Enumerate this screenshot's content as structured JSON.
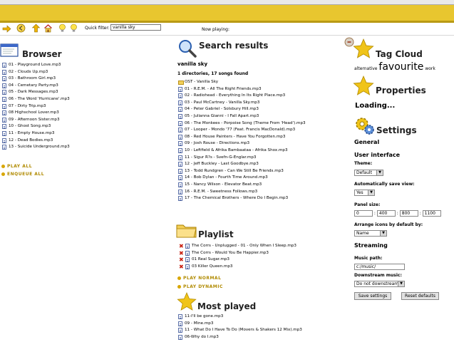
{
  "toolbar": {
    "quick_filter_label": "Quick filter:",
    "quick_filter_value": "vanilla sky",
    "now_playing_label": "Now playing:",
    "icons": [
      "arrow-right-icon",
      "back-icon",
      "up-arrow-icon",
      "home-icon",
      "bulb-icon",
      "bulb-icon"
    ]
  },
  "browser": {
    "title": "Browser",
    "files": [
      "01 - Playground Love.mp3",
      "02 - Clouds Up.mp3",
      "03 - Bathroom Girl.mp3",
      "04 - Cemetary Party.mp3",
      "05 - Dark Messages.mp3",
      "06 - The Word 'Hurricane'.mp3",
      "07 - Dirty Trip.mp3",
      "08 Highschool Lover.mp3",
      "09 - Afternoon Sister.mp3",
      "10 - Ghost Song.mp3",
      "11 - Empty House.mp3",
      "12 - Dead Bodies.mp3",
      "13 - Suicide Underground.mp3"
    ],
    "play_all": "PLAY ALL",
    "enqueue_all": "ENQUEUE ALL"
  },
  "search": {
    "title": "Search results",
    "query": "vanilla sky",
    "summary": "1 directories, 17 songs found",
    "folder": "OST - Vanilla Sky",
    "files": [
      "01 - R.E.M. - All The Right Friends.mp3",
      "02 - Radiohead - Everything In Its Right Place.mp3",
      "03 - Paul McCartney - Vanilla Sky.mp3",
      "04 - Peter Gabriel - Solsbury Hill.mp3",
      "05 - Julianna Gianni - I Fall Apart.mp3",
      "06 - The Monkees - Porpoise Song (Theme From 'Head').mp3",
      "07 - Looper - Mondo '77 (Feat. Francis MacDonald).mp3",
      "08 - Red House Painters - Have You Forgotten.mp3",
      "09 - Josh Rouse - Directions.mp3",
      "10 - Leftfield & Afrika Bambaataa - Afrika Shox.mp3",
      "11 - Sigur R?s - Svefn-G-Englar.mp3",
      "12 - Jeff Buckley - Last Goodbye.mp3",
      "13 - Todd Rundgren - Can We Still Be Friends.mp3",
      "14 - Bob Dylan - Fourth Time Around.mp3",
      "15 - Nancy Wilson - Elevator Beat.mp3",
      "16 - R.E.M. - Sweetness Follows.mp3",
      "17 - The Chemical Brothers - Where Do I Begin.mp3"
    ]
  },
  "playlist": {
    "title": "Playlist",
    "items": [
      "The Corrs - Unplugged - 01 - Only When I Sleep.mp3",
      "The Corrs - Would You Be Happier.mp3",
      "01 Real Sugar.mp3",
      "03 Killer Queen.mp3"
    ],
    "play_normal": "PLAY NORMAL",
    "play_dynamic": "PLAY DYNAMIC"
  },
  "most_played": {
    "title": "Most played",
    "items": [
      "11-I'll be gone.mp3",
      "09 - Mine.mp3",
      "11 - What Do I Have To Do (Movers & Shakers 12 Mix).mp3",
      "06-Why do I.mp3"
    ]
  },
  "tag_cloud": {
    "title": "Tag Cloud",
    "tags": [
      {
        "label": "alternative",
        "size": "small"
      },
      {
        "label": "favourite",
        "size": "large"
      },
      {
        "label": "work",
        "size": "small"
      }
    ]
  },
  "properties": {
    "title": "Properties",
    "loading": "Loading..."
  },
  "settings": {
    "title": "Settings",
    "general": "General",
    "user_interface": "User interface",
    "theme_label": "Theme:",
    "theme_value": "Default",
    "autosave_label": "Automatically save view:",
    "autosave_value": "Yes",
    "panel_size_label": "Panel size:",
    "panel_sizes": [
      "0",
      "400",
      "800",
      "1100"
    ],
    "panel_sep": ":",
    "arrange_label": "Arrange icons by default by:",
    "arrange_value": "Name",
    "streaming": "Streaming",
    "music_path_label": "Music path:",
    "music_path_value": "c:/music/",
    "downstream_label": "Downstream music:",
    "downstream_value": "Do not downstream",
    "save_button": "Save settings",
    "reset_button": "Reset defaults"
  },
  "colors": {
    "banner": "#e8c62f",
    "star": "#f0c419",
    "accent_text": "#b08a00",
    "delete_red": "#c81e10",
    "link_blue": "#5a6fa8"
  }
}
